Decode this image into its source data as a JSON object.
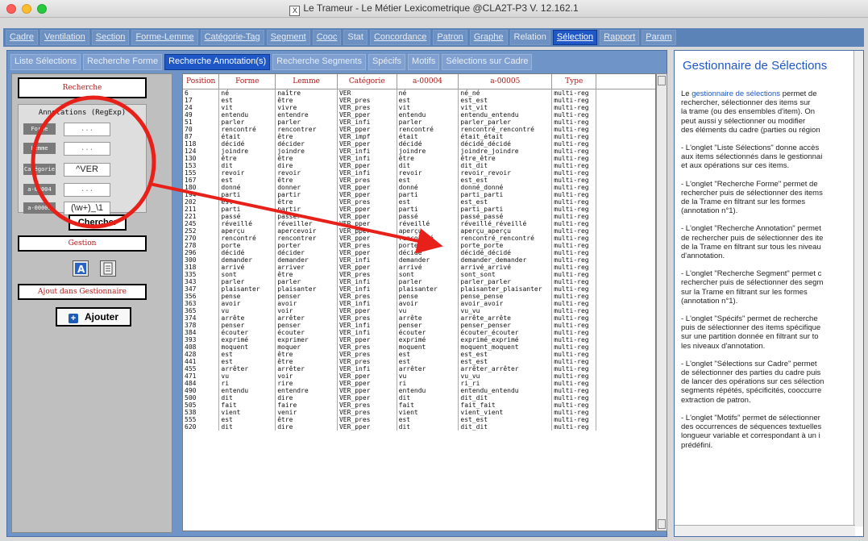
{
  "window": {
    "title": "Le Trameur - Le Métier Lexicometrique @CLA2T-P3 V. 12.162.1",
    "icon": "X"
  },
  "main_tabs": [
    {
      "label": "Cadre",
      "active": false
    },
    {
      "label": "Ventilation",
      "active": false
    },
    {
      "label": "Section",
      "active": false
    },
    {
      "label": "Forme-Lemme",
      "active": false
    },
    {
      "label": "Catégorie-Tag",
      "active": false
    },
    {
      "label": "Segment",
      "active": false
    },
    {
      "label": "Cooc",
      "active": false
    },
    {
      "label": "Stat",
      "active": false
    },
    {
      "label": "Concordance",
      "active": false
    },
    {
      "label": "Patron",
      "active": false
    },
    {
      "label": "Graphe",
      "active": false
    },
    {
      "label": "Relation",
      "active": false
    },
    {
      "label": "Sélection",
      "active": true
    },
    {
      "label": "Rapport",
      "active": false
    },
    {
      "label": "Param",
      "active": false
    }
  ],
  "sub_tabs": [
    {
      "label": "Liste Sélections",
      "active": false
    },
    {
      "label": "Recherche Forme",
      "active": false
    },
    {
      "label": "Recherche Annotation(s)",
      "active": true
    },
    {
      "label": "Recherche Segments",
      "active": false
    },
    {
      "label": "Spécifs",
      "active": false
    },
    {
      "label": "Motifs",
      "active": false
    },
    {
      "label": "Sélections sur Cadre",
      "active": false
    }
  ],
  "left": {
    "recherche_label": "Recherche",
    "annot_title": "Annotations (RegExp)",
    "fields": [
      {
        "label": "Forme",
        "value": "...",
        "filled": false
      },
      {
        "label": "Lemme",
        "value": "...",
        "filled": false
      },
      {
        "label": "Catégorie",
        "value": "^VER",
        "filled": true
      },
      {
        "label": "a-00004",
        "value": "...",
        "filled": false
      },
      {
        "label": "a-00005",
        "value": "(\\w+)_\\1",
        "filled": true
      }
    ],
    "search_button": "Chercher",
    "gestion_label": "Gestion",
    "ajout_label": "Ajout dans Gestionnaire",
    "add_button": "Ajouter"
  },
  "table": {
    "columns": [
      "Position",
      "Forme",
      "Lemme",
      "Catégorie",
      "a-00004",
      "a-00005",
      "Type"
    ],
    "rows": [
      [
        "6",
        "né",
        "naître",
        "VER",
        "né",
        "né_né",
        "multi-reg"
      ],
      [
        "17",
        "est",
        "être",
        "VER_pres",
        "est",
        "est_est",
        "multi-reg"
      ],
      [
        "24",
        "vit",
        "vivre",
        "VER_pres",
        "vit",
        "vit_vit",
        "multi-reg"
      ],
      [
        "49",
        "entendu",
        "entendre",
        "VER_pper",
        "entendu",
        "entendu_entendu",
        "multi-reg"
      ],
      [
        "51",
        "parler",
        "parler",
        "VER_infi",
        "parler",
        "parler_parler",
        "multi-reg"
      ],
      [
        "70",
        "rencontré",
        "rencontrer",
        "VER_pper",
        "rencontré",
        "rencontré_rencontré",
        "multi-reg"
      ],
      [
        "87",
        "était",
        "être",
        "VER_impf",
        "était",
        "était_était",
        "multi-reg"
      ],
      [
        "118",
        "décidé",
        "décider",
        "VER_pper",
        "décidé",
        "décidé_décidé",
        "multi-reg"
      ],
      [
        "124",
        "joindre",
        "joindre",
        "VER_infi",
        "joindre",
        "joindre_joindre",
        "multi-reg"
      ],
      [
        "130",
        "être",
        "être",
        "VER_infi",
        "être",
        "être_être",
        "multi-reg"
      ],
      [
        "153",
        "dit",
        "dire",
        "VER_pper",
        "dit",
        "dit_dit",
        "multi-reg"
      ],
      [
        "155",
        "revoir",
        "revoir",
        "VER_infi",
        "revoir",
        "revoir_revoir",
        "multi-reg"
      ],
      [
        "167",
        "est",
        "être",
        "VER_pres",
        "est",
        "est_est",
        "multi-reg"
      ],
      [
        "180",
        "donné",
        "donner",
        "VER_pper",
        "donné",
        "donné_donné",
        "multi-reg"
      ],
      [
        "194",
        "parti",
        "partir",
        "VER_pper",
        "parti",
        "parti_parti",
        "multi-reg"
      ],
      [
        "202",
        "est",
        "être",
        "VER_pres",
        "est",
        "est_est",
        "multi-reg"
      ],
      [
        "211",
        "parti",
        "partir",
        "VER_pper",
        "parti",
        "parti_parti",
        "multi-reg"
      ],
      [
        "221",
        "passé",
        "passer",
        "VER_pper",
        "passé",
        "passé_passé",
        "multi-reg"
      ],
      [
        "245",
        "réveillé",
        "réveiller",
        "VER_pper",
        "réveillé",
        "réveillé_réveillé",
        "multi-reg"
      ],
      [
        "252",
        "aperçu",
        "apercevoir",
        "VER_pper",
        "aperçu",
        "aperçu_aperçu",
        "multi-reg"
      ],
      [
        "270",
        "rencontré",
        "rencontrer",
        "VER_pper",
        "rencontré",
        "rencontré_rencontré",
        "multi-reg"
      ],
      [
        "278",
        "porte",
        "porter",
        "VER_pres",
        "porte",
        "porte_porte",
        "multi-reg"
      ],
      [
        "296",
        "décidé",
        "décider",
        "VER_pper",
        "décidé",
        "décidé_décidé",
        "multi-reg"
      ],
      [
        "300",
        "demander",
        "demander",
        "VER_infi",
        "demander",
        "demander_demander",
        "multi-reg"
      ],
      [
        "318",
        "arrivé",
        "arriver",
        "VER_pper",
        "arrivé",
        "arrivé_arrivé",
        "multi-reg"
      ],
      [
        "335",
        "sont",
        "être",
        "VER_pres",
        "sont",
        "sont_sont",
        "multi-reg"
      ],
      [
        "343",
        "parler",
        "parler",
        "VER_infi",
        "parler",
        "parler_parler",
        "multi-reg"
      ],
      [
        "347",
        "plaisanter",
        "plaisanter",
        "VER_infi",
        "plaisanter",
        "plaisanter_plaisanter",
        "multi-reg"
      ],
      [
        "356",
        "pense",
        "penser",
        "VER_pres",
        "pense",
        "pense_pense",
        "multi-reg"
      ],
      [
        "363",
        "avoir",
        "avoir",
        "VER_infi",
        "avoir",
        "avoir_avoir",
        "multi-reg"
      ],
      [
        "365",
        "vu",
        "voir",
        "VER_pper",
        "vu",
        "vu_vu",
        "multi-reg"
      ],
      [
        "374",
        "arrête",
        "arrêter",
        "VER_pres",
        "arrête",
        "arrête_arrête",
        "multi-reg"
      ],
      [
        "378",
        "penser",
        "penser",
        "VER_infi",
        "penser",
        "penser_penser",
        "multi-reg"
      ],
      [
        "384",
        "écouter",
        "écouter",
        "VER_infi",
        "écouter",
        "écouter_écouter",
        "multi-reg"
      ],
      [
        "393",
        "exprimé",
        "exprimer",
        "VER_pper",
        "exprimé",
        "exprimé_exprimé",
        "multi-reg"
      ],
      [
        "408",
        "moquent",
        "moquer",
        "VER_pres",
        "moquent",
        "moquent_moquent",
        "multi-reg"
      ],
      [
        "428",
        "est",
        "être",
        "VER_pres",
        "est",
        "est_est",
        "multi-reg"
      ],
      [
        "441",
        "est",
        "être",
        "VER_pres",
        "est",
        "est_est",
        "multi-reg"
      ],
      [
        "455",
        "arrêter",
        "arrêter",
        "VER_infi",
        "arrêter",
        "arrêter_arrêter",
        "multi-reg"
      ],
      [
        "471",
        "vu",
        "voir",
        "VER_pper",
        "vu",
        "vu_vu",
        "multi-reg"
      ],
      [
        "484",
        "ri",
        "rire",
        "VER_pper",
        "ri",
        "ri_ri",
        "multi-reg"
      ],
      [
        "490",
        "entendu",
        "entendre",
        "VER_pper",
        "entendu",
        "entendu_entendu",
        "multi-reg"
      ],
      [
        "500",
        "dit",
        "dire",
        "VER_pper",
        "dit",
        "dit_dit",
        "multi-reg"
      ],
      [
        "505",
        "fait",
        "faire",
        "VER_pres",
        "fait",
        "fait_fait",
        "multi-reg"
      ],
      [
        "538",
        "vient",
        "venir",
        "VER_pres",
        "vient",
        "vient_vient",
        "multi-reg"
      ],
      [
        "555",
        "est",
        "être",
        "VER_pres",
        "est",
        "est_est",
        "multi-reg"
      ],
      [
        "620",
        "dit",
        "dire",
        "VER_pper",
        "dit",
        "dit_dit",
        "multi-reg"
      ]
    ]
  },
  "right": {
    "title": "Gestionnaire de Sélections",
    "paragraphs": [
      [
        "Le ",
        "gestionnaire de sélections",
        " permet de",
        "rechercher, sélectionner des items sur",
        "la trame (ou des ensembles d'item). On",
        "peut aussi y sélectionner ou modifier",
        "des éléments du cadre (parties ou région"
      ],
      [
        "- L'onglet \"Liste Sélections\" donne accès",
        "aux items sélectionnés dans le gestionnai",
        "et aux opérations sur ces items."
      ],
      [
        "- L'onglet \"Recherche Forme\" permet de",
        "rechercher puis de sélectionner des items",
        "de la Trame en filtrant sur les formes",
        "(annotation n°1)."
      ],
      [
        "- L'onglet \"Recherche Annotation\" permet",
        "de rechercher puis de sélectionner des ite",
        "de la Trame en filtrant sur tous les niveau",
        "d'annotation."
      ],
      [
        "- L'onglet \"Recherche Segment\" permet c",
        "rechercher puis de sélectionner des segm",
        "sur la Trame en filtrant sur les formes",
        "(annotation n°1)."
      ],
      [
        "- L'onglet \"Spécifs\" permet de  recherche",
        "puis de sélectionner des items spécifique",
        "sur une partition donnée en filtrant sur to",
        "les niveaux d'annotation."
      ],
      [
        "- L'onglet \"Sélections sur Cadre\" permet",
        "de sélectionner des parties du cadre puis",
        "de lancer des opérations sur ces sélection",
        "segments répétés, spécificités, cooccurre",
        "extraction de patron."
      ],
      [
        "- L'onglet \"Motifs\" permet de sélectionner",
        "des occurrences de séquences textuelles",
        "longueur variable et correspondant à un i",
        "prédéfini."
      ]
    ]
  },
  "colors": {
    "accent": "#1f58c6",
    "tabbar": "#5b83b8",
    "header_text": "#b01818",
    "annotation": "#e8201a"
  }
}
